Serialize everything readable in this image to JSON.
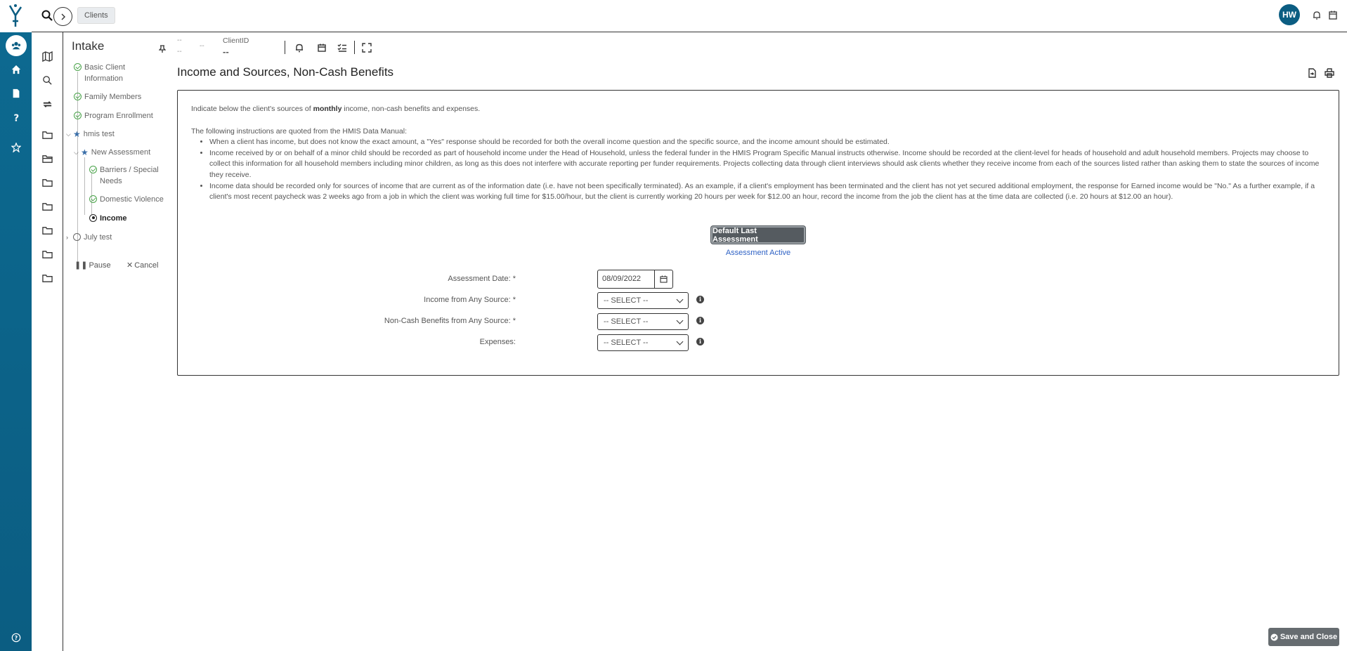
{
  "topbar": {
    "breadcrumb": "Clients",
    "avatar_initials": "HW"
  },
  "intake": {
    "title": "Intake",
    "items": [
      {
        "label": "Basic Client Information",
        "status": "complete"
      },
      {
        "label": "Family Members",
        "status": "complete"
      },
      {
        "label": "Program Enrollment",
        "status": "complete"
      },
      {
        "label": "hmis test",
        "status": "group"
      },
      {
        "label": "New Assessment",
        "status": "group"
      },
      {
        "label": "Barriers / Special Needs",
        "status": "complete"
      },
      {
        "label": "Domestic Violence",
        "status": "complete"
      },
      {
        "label": "Income",
        "status": "current"
      },
      {
        "label": "July test",
        "status": "pending"
      }
    ],
    "pause_label": "Pause",
    "cancel_label": "Cancel"
  },
  "client_header": {
    "placeholder_a": "--",
    "placeholder_b": "--",
    "placeholder_c": "--",
    "clientid_label": "ClientID",
    "clientid_value": "--"
  },
  "page": {
    "title": "Income and Sources, Non-Cash Benefits"
  },
  "instructions": {
    "intro_before": "Indicate below the client's sources of ",
    "intro_bold": "monthly",
    "intro_after": " income, non-cash benefits and expenses.",
    "quoted_intro": "The following instructions are quoted from the HMIS Data Manual:",
    "bullets": [
      "When a client has income, but does not know the exact amount, a \"Yes\" response should be recorded for both the overall income question and the specific source, and the income amount should be estimated.",
      "Income received by or on behalf of a minor child should be recorded as part of household income under the Head of Household, unless the federal funder in the HMIS Program Specific Manual instructs otherwise.  Income should be recorded at the client-level for heads of household and adult household members.  Projects may choose to collect this information for all household members including minor children, as long as this does not interfere with accurate reporting per funder requirements.  Projects collecting data through client interviews should ask clients whether they receive income from each of the sources listed rather than asking them to state the sources of income they receive.",
      "Income data should be recorded only for sources of income that are current as of the information date (i.e. have not been specifically terminated).  As an example, if a client's employment has been terminated and the client has not yet secured additional employment, the response for Earned income would be \"No.\"  As a further example, if a client's most recent paycheck was 2 weeks ago from a job in which the client was working full time for $15.00/hour, but the client is currently working 20 hours per week for $12.00 an hour, record the income from the job the client has at the time data are collected (i.e. 20 hours at $12.00 an hour)."
    ]
  },
  "assessment": {
    "default_button": "Default Last Assessment",
    "status_link": "Assessment Active"
  },
  "form": {
    "date_label": "Assessment Date: *",
    "date_value": "08/09/2022",
    "income_label": "Income from Any Source: *",
    "income_value": "-- SELECT --",
    "noncash_label": "Non-Cash Benefits from Any Source: *",
    "noncash_value": "-- SELECT --",
    "expenses_label": "Expenses:",
    "expenses_value": "-- SELECT --"
  },
  "footer": {
    "save_close": "Save and Close"
  }
}
